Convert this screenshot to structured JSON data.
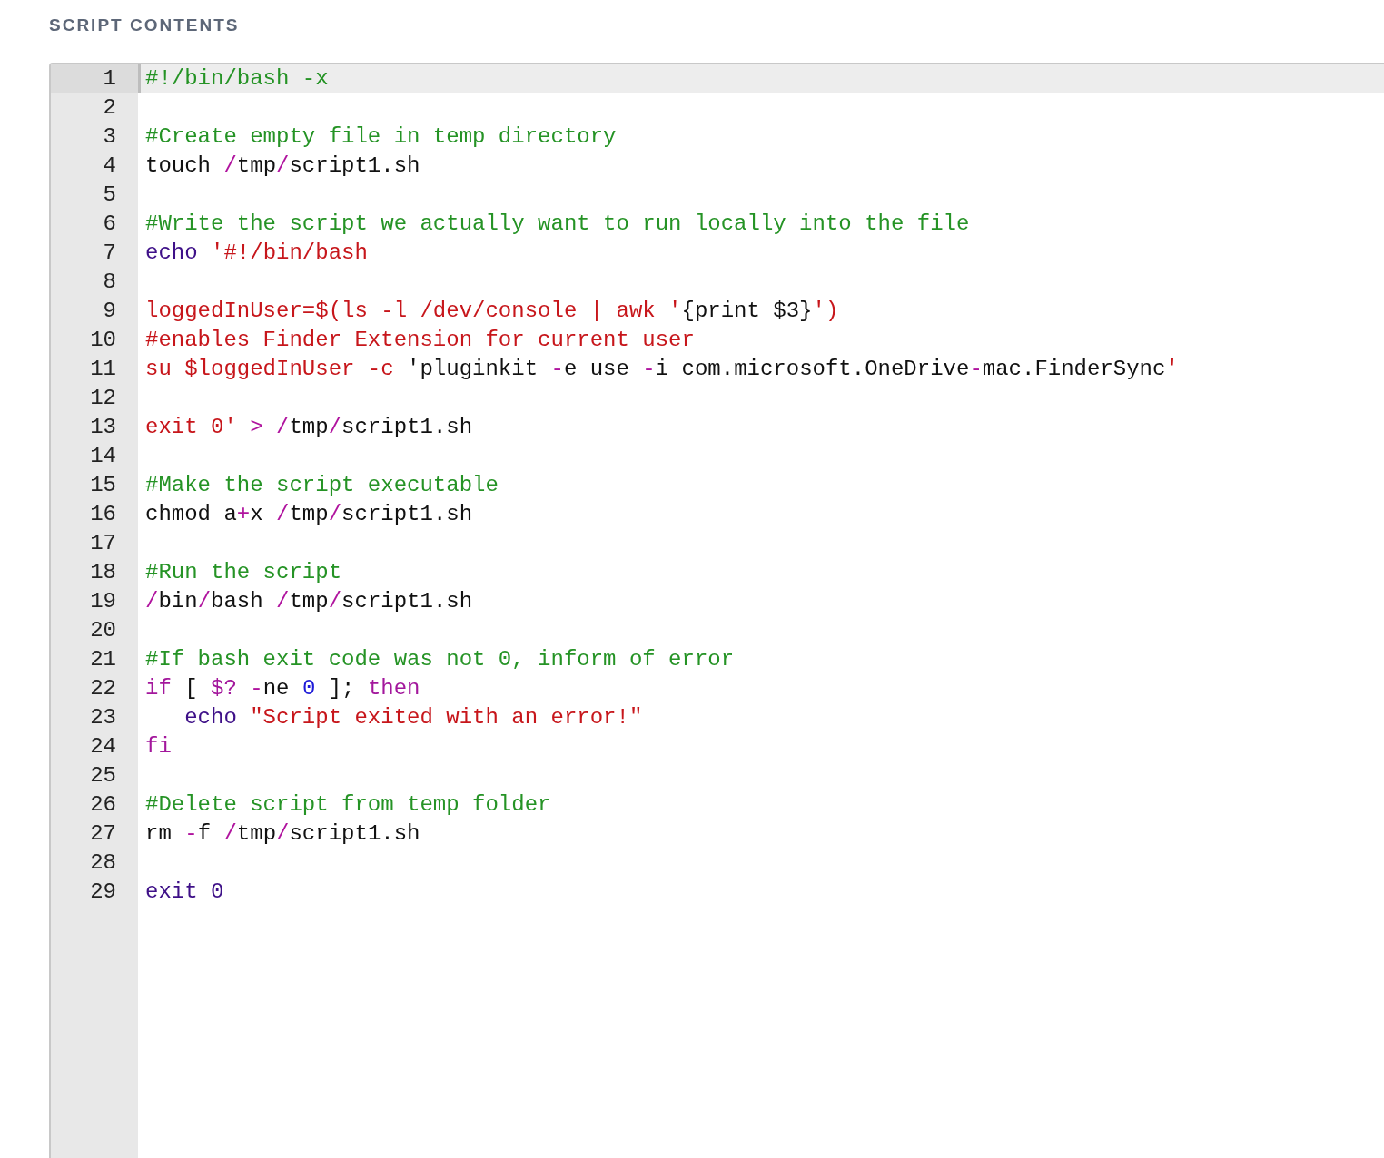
{
  "section_title": "SCRIPT CONTENTS",
  "editor": {
    "lines": [
      {
        "number": "1",
        "active": true,
        "tokens": [
          {
            "kind": "comment",
            "text": "#!/bin/bash -x"
          }
        ]
      },
      {
        "number": "2",
        "active": false
      },
      {
        "number": "3",
        "active": false,
        "tokens": [
          {
            "kind": "comment",
            "text": "#Create empty file in temp directory"
          }
        ]
      },
      {
        "number": "4",
        "active": false,
        "tokens": [
          {
            "kind": "plain",
            "text": "touch "
          },
          {
            "kind": "operator",
            "text": "/"
          },
          {
            "kind": "plain",
            "text": "tmp"
          },
          {
            "kind": "operator",
            "text": "/"
          },
          {
            "kind": "plain",
            "text": "script1.sh"
          }
        ]
      },
      {
        "number": "5",
        "active": false
      },
      {
        "number": "6",
        "active": false,
        "tokens": [
          {
            "kind": "comment",
            "text": "#Write the script we actually want to run locally into the file"
          }
        ]
      },
      {
        "number": "7",
        "active": false,
        "tokens": [
          {
            "kind": "builtin",
            "text": "echo "
          },
          {
            "kind": "string",
            "text": "'#!/bin/bash"
          }
        ]
      },
      {
        "number": "8",
        "active": false
      },
      {
        "number": "9",
        "active": false,
        "tokens": [
          {
            "kind": "string",
            "text": "loggedInUser=$(ls -l /dev/console | awk '"
          },
          {
            "kind": "plain",
            "text": "{print $3}"
          },
          {
            "kind": "string",
            "text": "')"
          }
        ]
      },
      {
        "number": "10",
        "active": false,
        "tokens": [
          {
            "kind": "string",
            "text": "#enables Finder Extension for current user"
          }
        ]
      },
      {
        "number": "11",
        "active": false,
        "tokens": [
          {
            "kind": "string",
            "text": "su $loggedInUser -c "
          },
          {
            "kind": "plain",
            "text": "'pluginkit "
          },
          {
            "kind": "operator",
            "text": "-"
          },
          {
            "kind": "plain",
            "text": "e use "
          },
          {
            "kind": "operator",
            "text": "-"
          },
          {
            "kind": "plain",
            "text": "i com.microsoft.OneDrive"
          },
          {
            "kind": "operator",
            "text": "-"
          },
          {
            "kind": "plain",
            "text": "mac.FinderSync"
          },
          {
            "kind": "string",
            "text": "'"
          }
        ]
      },
      {
        "number": "12",
        "active": false
      },
      {
        "number": "13",
        "active": false,
        "tokens": [
          {
            "kind": "string",
            "text": "exit 0' "
          },
          {
            "kind": "operator",
            "text": "> /"
          },
          {
            "kind": "plain",
            "text": "tmp"
          },
          {
            "kind": "operator",
            "text": "/"
          },
          {
            "kind": "plain",
            "text": "script1.sh"
          }
        ]
      },
      {
        "number": "14",
        "active": false
      },
      {
        "number": "15",
        "active": false,
        "tokens": [
          {
            "kind": "comment",
            "text": "#Make the script executable"
          }
        ]
      },
      {
        "number": "16",
        "active": false,
        "tokens": [
          {
            "kind": "plain",
            "text": "chmod a"
          },
          {
            "kind": "operator",
            "text": "+"
          },
          {
            "kind": "plain",
            "text": "x "
          },
          {
            "kind": "operator",
            "text": "/"
          },
          {
            "kind": "plain",
            "text": "tmp"
          },
          {
            "kind": "operator",
            "text": "/"
          },
          {
            "kind": "plain",
            "text": "script1.sh"
          }
        ]
      },
      {
        "number": "17",
        "active": false
      },
      {
        "number": "18",
        "active": false,
        "tokens": [
          {
            "kind": "comment",
            "text": "#Run the script"
          }
        ]
      },
      {
        "number": "19",
        "active": false,
        "tokens": [
          {
            "kind": "operator",
            "text": "/"
          },
          {
            "kind": "plain",
            "text": "bin"
          },
          {
            "kind": "operator",
            "text": "/"
          },
          {
            "kind": "plain",
            "text": "bash "
          },
          {
            "kind": "operator",
            "text": "/"
          },
          {
            "kind": "plain",
            "text": "tmp"
          },
          {
            "kind": "operator",
            "text": "/"
          },
          {
            "kind": "plain",
            "text": "script1.sh"
          }
        ]
      },
      {
        "number": "20",
        "active": false
      },
      {
        "number": "21",
        "active": false,
        "tokens": [
          {
            "kind": "comment",
            "text": "#If bash exit code was not 0, inform of error"
          }
        ]
      },
      {
        "number": "22",
        "active": false,
        "tokens": [
          {
            "kind": "keyword",
            "text": "if"
          },
          {
            "kind": "plain",
            "text": " [ "
          },
          {
            "kind": "keyword",
            "text": "$? "
          },
          {
            "kind": "operator",
            "text": "-"
          },
          {
            "kind": "plain",
            "text": "ne "
          },
          {
            "kind": "number",
            "text": "0"
          },
          {
            "kind": "plain",
            "text": " ]; "
          },
          {
            "kind": "keyword",
            "text": "then"
          }
        ]
      },
      {
        "number": "23",
        "active": false,
        "tokens": [
          {
            "kind": "builtin",
            "text": "   echo "
          },
          {
            "kind": "string",
            "text": "\"Script exited with an error!\""
          }
        ]
      },
      {
        "number": "24",
        "active": false,
        "tokens": [
          {
            "kind": "keyword",
            "text": "fi"
          }
        ]
      },
      {
        "number": "25",
        "active": false
      },
      {
        "number": "26",
        "active": false,
        "tokens": [
          {
            "kind": "comment",
            "text": "#Delete script from temp folder"
          }
        ]
      },
      {
        "number": "27",
        "active": false,
        "tokens": [
          {
            "kind": "plain",
            "text": "rm "
          },
          {
            "kind": "operator",
            "text": "-"
          },
          {
            "kind": "plain",
            "text": "f "
          },
          {
            "kind": "operator",
            "text": "/"
          },
          {
            "kind": "plain",
            "text": "tmp"
          },
          {
            "kind": "operator",
            "text": "/"
          },
          {
            "kind": "plain",
            "text": "script1.sh"
          }
        ]
      },
      {
        "number": "28",
        "active": false
      },
      {
        "number": "29",
        "active": false,
        "tokens": [
          {
            "kind": "builtin",
            "text": "exit 0"
          }
        ]
      }
    ]
  }
}
